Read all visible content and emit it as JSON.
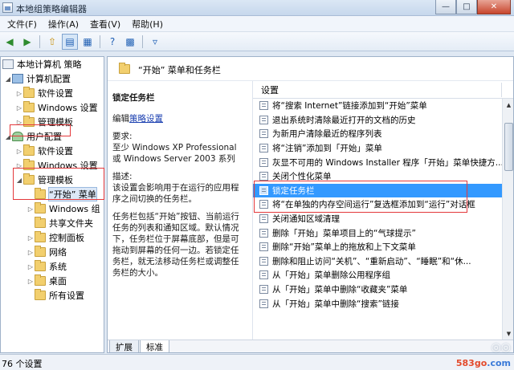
{
  "window": {
    "title": "本地组策略编辑器",
    "minimize_glyph": "—",
    "maximize_glyph": "□",
    "close_glyph": "✕"
  },
  "menu": [
    {
      "label": "文件(F)"
    },
    {
      "label": "操作(A)"
    },
    {
      "label": "查看(V)"
    },
    {
      "label": "帮助(H)"
    }
  ],
  "toolbar": {
    "icons": [
      "back-arrow-icon",
      "forward-arrow-icon",
      "up-folder-icon",
      "show-hide-tree-icon",
      "properties-icon",
      "help-icon",
      "export-list-icon",
      "filter-icon"
    ]
  },
  "tree": {
    "items": [
      {
        "label": "本地计算机 策略"
      },
      {
        "label": "计算机配置"
      },
      {
        "label": "软件设置"
      },
      {
        "label": "Windows 设置"
      },
      {
        "label": "管理模板"
      },
      {
        "label": "用户配置"
      },
      {
        "label": "软件设置"
      },
      {
        "label": "Windows 设置"
      },
      {
        "label": "管理模板"
      },
      {
        "label": "“开始” 菜单"
      },
      {
        "label": "Windows 组"
      },
      {
        "label": "共享文件夹"
      },
      {
        "label": "控制面板"
      },
      {
        "label": "网络"
      },
      {
        "label": "系统"
      },
      {
        "label": "桌面"
      },
      {
        "label": "所有设置"
      }
    ]
  },
  "main": {
    "header_title": "“开始” 菜单和任务栏",
    "description": {
      "title": "锁定任务栏",
      "edit_prefix": "编辑",
      "edit_link": "策略设置",
      "requirements_label": "要求:",
      "requirements_text": "至少 Windows XP Professional 或 Windows Server 2003 系列",
      "description_label": "描述:",
      "paragraph1": "该设置会影响用于在运行的应用程序之间切换的任务栏。",
      "paragraph2": "任务栏包括“开始”按钮、当前运行任务的列表和通知区域。默认情况下，任务栏位于屏幕底部，但是可拖动到屏幕的任何一边。若锁定任务栏，就无法移动任务栏或调整任务栏的大小。"
    },
    "column_header": "设置",
    "settings": [
      {
        "label": "将“搜索 Internet”链接添加到“开始”菜单"
      },
      {
        "label": "退出系统时清除最近打开的文档的历史"
      },
      {
        "label": "为新用户清除最近的程序列表"
      },
      {
        "label": "将“注销”添加到「开始」菜单"
      },
      {
        "label": "灰显不可用的 Windows Installer 程序「开始」菜单快捷方..."
      },
      {
        "label": "关闭个性化菜单"
      },
      {
        "label": "锁定任务栏"
      },
      {
        "label": "将“在单独的内存空间运行”复选框添加到“运行”对话框"
      },
      {
        "label": "关闭通知区域清理"
      },
      {
        "label": "删除「开始」菜单项目上的“气球提示”"
      },
      {
        "label": "删除“开始”菜单上的拖放和上下文菜单"
      },
      {
        "label": "删除和阻止访问“关机”、“重新启动”、“睡眠”和“休..."
      },
      {
        "label": "从「开始」菜单删除公用程序组"
      },
      {
        "label": "从「开始」菜单中删除“收藏夹”菜单"
      },
      {
        "label": "从「开始」菜单中删除“搜索”链接"
      }
    ],
    "tabs": [
      {
        "label": "扩展"
      },
      {
        "label": "标准"
      }
    ]
  },
  "status": {
    "text": "76 个设置"
  },
  "watermark": {
    "url_prefix": "583go",
    "url_suffix": ".com"
  },
  "colors": {
    "selection": "#3399ff",
    "annotation_red": "#e4383b",
    "link_blue": "#1a3fb0"
  }
}
